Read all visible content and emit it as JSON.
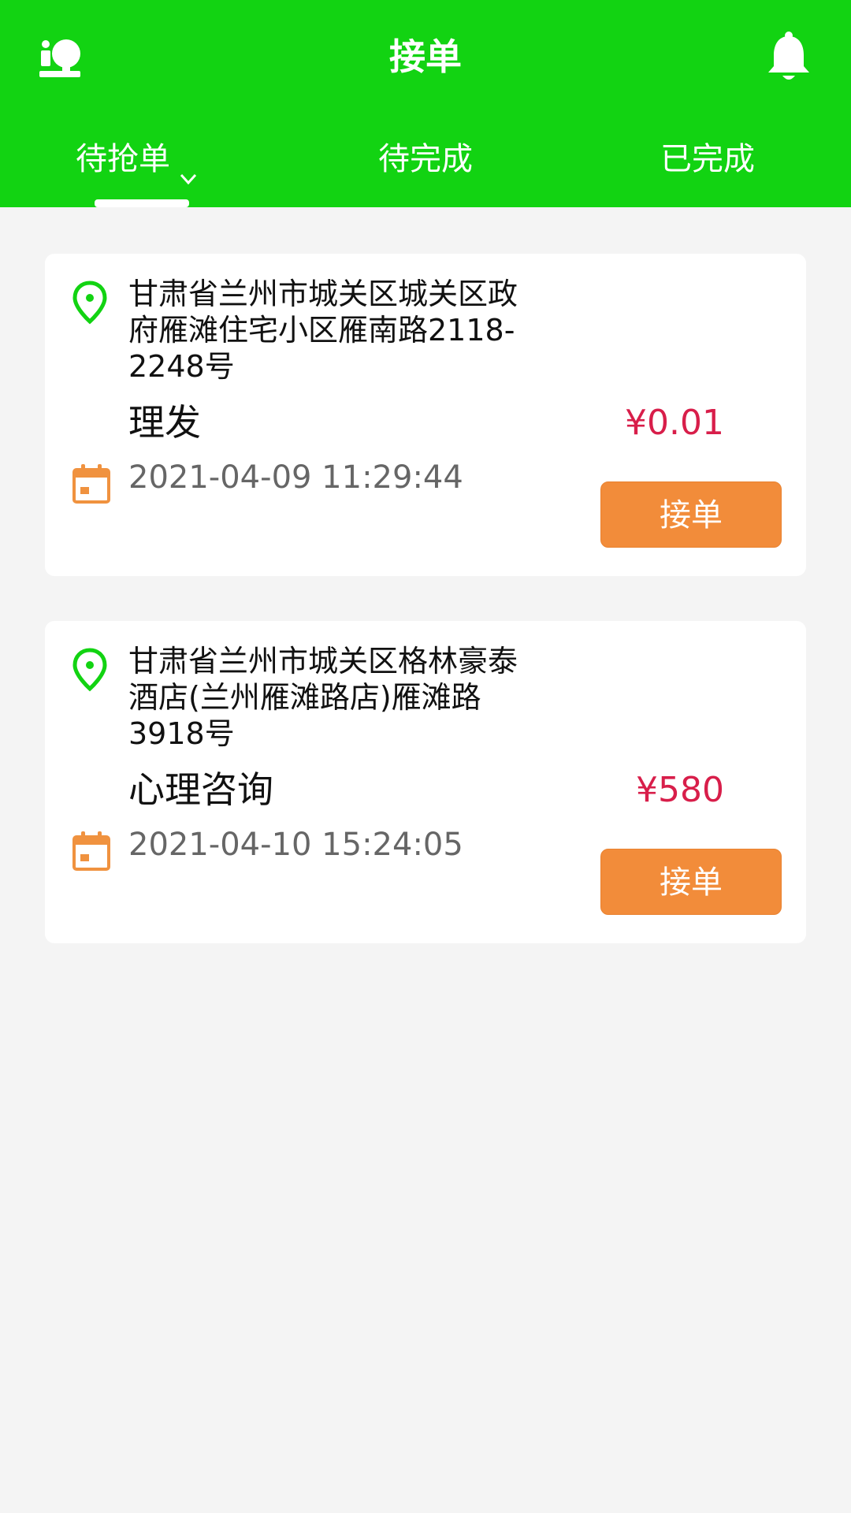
{
  "header": {
    "title": "接单",
    "left_icon": "consultant-profile-icon",
    "right_icon": "bell-icon",
    "background": "#12d312"
  },
  "tabs": [
    {
      "label": "待抢单",
      "active": true,
      "has_dropdown": true
    },
    {
      "label": "待完成",
      "active": false
    },
    {
      "label": "已完成",
      "active": false
    }
  ],
  "orders": [
    {
      "address": "甘肃省兰州市城关区城关区政府雁滩住宅小区雁南路2118-2248号",
      "service": "理发",
      "price": "¥0.01",
      "datetime": "2021-04-09 11:29:44",
      "button_label": "接单"
    },
    {
      "address": "甘肃省兰州市城关区格林豪泰酒店(兰州雁滩路店)雁滩路3918号",
      "service": "心理咨询",
      "price": "¥580",
      "datetime": "2021-04-10 15:24:05",
      "button_label": "接单"
    }
  ],
  "colors": {
    "accent_green": "#12d312",
    "button_orange": "#f28c3a",
    "price_red": "#d81e4a",
    "calendar_orange": "#f0923f"
  }
}
